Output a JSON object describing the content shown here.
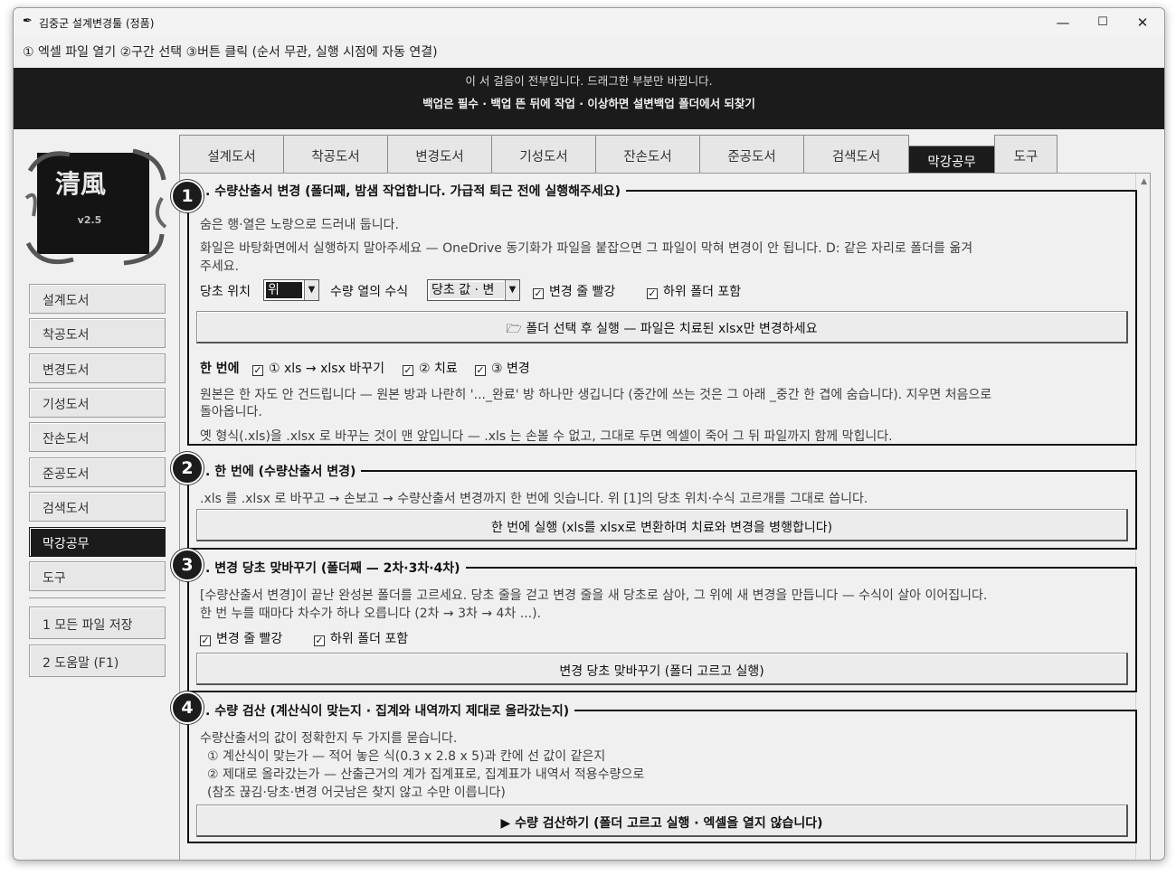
{
  "window": {
    "title": "김중군 설계변경툴 (정품)",
    "controls": {
      "minimize": "—",
      "maximize": "☐",
      "close": "✕"
    }
  },
  "stepbar": "① 엑셀 파일 열기  ②구간 선택  ③버튼 클릭 (순서 무관, 실행 시점에 자동 연결)",
  "banner": {
    "line1": "이 서 걸음이 전부입니다. 드래그한 부분만 바뀝니다.",
    "line2": "백업은 필수 · 백업 뜬 뒤에 작업 · 이상하면 설변백업 폴더에서 되찾기"
  },
  "logo": {
    "text": "清風",
    "version": "v2.5"
  },
  "sidebar": {
    "items": [
      {
        "label": "설계도서",
        "active": false
      },
      {
        "label": "착공도서",
        "active": false
      },
      {
        "label": "변경도서",
        "active": false
      },
      {
        "label": "기성도서",
        "active": false
      },
      {
        "label": "잔손도서",
        "active": false
      },
      {
        "label": "준공도서",
        "active": false
      },
      {
        "label": "검색도서",
        "active": false
      },
      {
        "label": "막강공무",
        "active": true
      },
      {
        "label": "도구",
        "active": false
      }
    ],
    "save_all": "1 모든 파일 저장",
    "help": "2 도움말 (F1)"
  },
  "tabs": [
    {
      "label": "설계도서",
      "active": false
    },
    {
      "label": "착공도서",
      "active": false
    },
    {
      "label": "변경도서",
      "active": false
    },
    {
      "label": "기성도서",
      "active": false
    },
    {
      "label": "잔손도서",
      "active": false
    },
    {
      "label": "준공도서",
      "active": false
    },
    {
      "label": "검색도서",
      "active": false
    },
    {
      "label": "막강공무",
      "active": true
    },
    {
      "label": "도구",
      "active": false
    }
  ],
  "section1": {
    "badge": "1",
    "title": ". 수량산출서 변경 (폴더째, 밤샘 작업합니다. 가급적 퇴근 전에 실행해주세요)",
    "desc1": "숨은 행·열은 노랑으로 드러내 둡니다.",
    "desc2": "화일은 바탕화면에서 실행하지 말아주세요 — OneDrive 동기화가 파일을 붙잡으면 그 파일이 막혀 변경이 안 됩니다. D: 같은 자리로 폴더를 옮겨",
    "desc3": "주세요.",
    "origin_label": "당초 위치",
    "origin_value": "위",
    "formula_label": "수량 열의 수식",
    "formula_value": "당초 값 · 변",
    "chk_red": "변경 줄 빨강",
    "chk_sub": "하위 폴더 포함",
    "run_button": "폴더 선택 후 실행 — 파일은 치료된 xlsx만 변경하세요",
    "once_label": "한 번에",
    "chk_convert": "① xls → xlsx 바꾸기",
    "chk_cure": "② 치료",
    "chk_change": "③ 변경",
    "note1": "원본은 한 자도 안 건드립니다 — 원본 방과 나란히 '..._완료' 방 하나만 생깁니다 (중간에 쓰는 것은 그 아래 _중간 한 겹에 숨습니다). 지우면 처음으로",
    "note2": "돌아옵니다.",
    "note3": "옛 형식(.xls)을 .xlsx 로 바꾸는 것이 맨 앞입니다 — .xls 는 손볼 수 없고, 그대로 두면 엑셀이 죽어 그 뒤 파일까지 함께 막힙니다."
  },
  "section2": {
    "badge": "2",
    "title": ". 한 번에 (수량산출서 변경)",
    "desc": ".xls 를 .xlsx 로 바꾸고 → 손보고 → 수량산출서 변경까지 한 번에 잇습니다. 위 [1]의 당초 위치·수식 고르개를 그대로 씁니다.",
    "button": "한 번에 실행 (xls를 xlsx로 변환하며 치료와 변경을 병행합니다)"
  },
  "section3": {
    "badge": "3",
    "title": ". 변경 당초 맞바꾸기 (폴더째 — 2차·3차·4차)",
    "desc1": "[수량산출서 변경]이 끝난 완성본 폴더를 고르세요. 당초 줄을 걷고 변경 줄을 새 당초로 삼아, 그 위에 새 변경을 만듭니다 — 수식이 살아 이어집니다.",
    "desc2": "한 번 누를 때마다 차수가 하나 오릅니다 (2차 → 3차 → 4차 ...).",
    "chk_red": "변경 줄 빨강",
    "chk_sub": "하위 폴더 포함",
    "button": "변경 당초 맞바꾸기 (폴더 고르고 실행)"
  },
  "section4": {
    "badge": "4",
    "title": ". 수량 검산 (계산식이 맞는지 · 집계와 내역까지 제대로 올라갔는지)",
    "desc1": "수량산출서의 값이 정확한지 두 가지를 묻습니다.",
    "desc2": "① 계산식이 맞는가 — 적어 놓은 식(0.3 x 2.8 x 5)과 칸에 선 값이 같은지",
    "desc3": "② 제대로 올라갔는가 — 산출근거의 계가 집계표로, 집계표가 내역서 적용수량으로",
    "desc4": "(참조 끊김·당초·변경 어긋남은 찾지 않고 수만 이릅니다)",
    "button": "▶ 수량 검산하기 (폴더 고르고 실행 · 엑셀을 열지 않습니다)"
  }
}
